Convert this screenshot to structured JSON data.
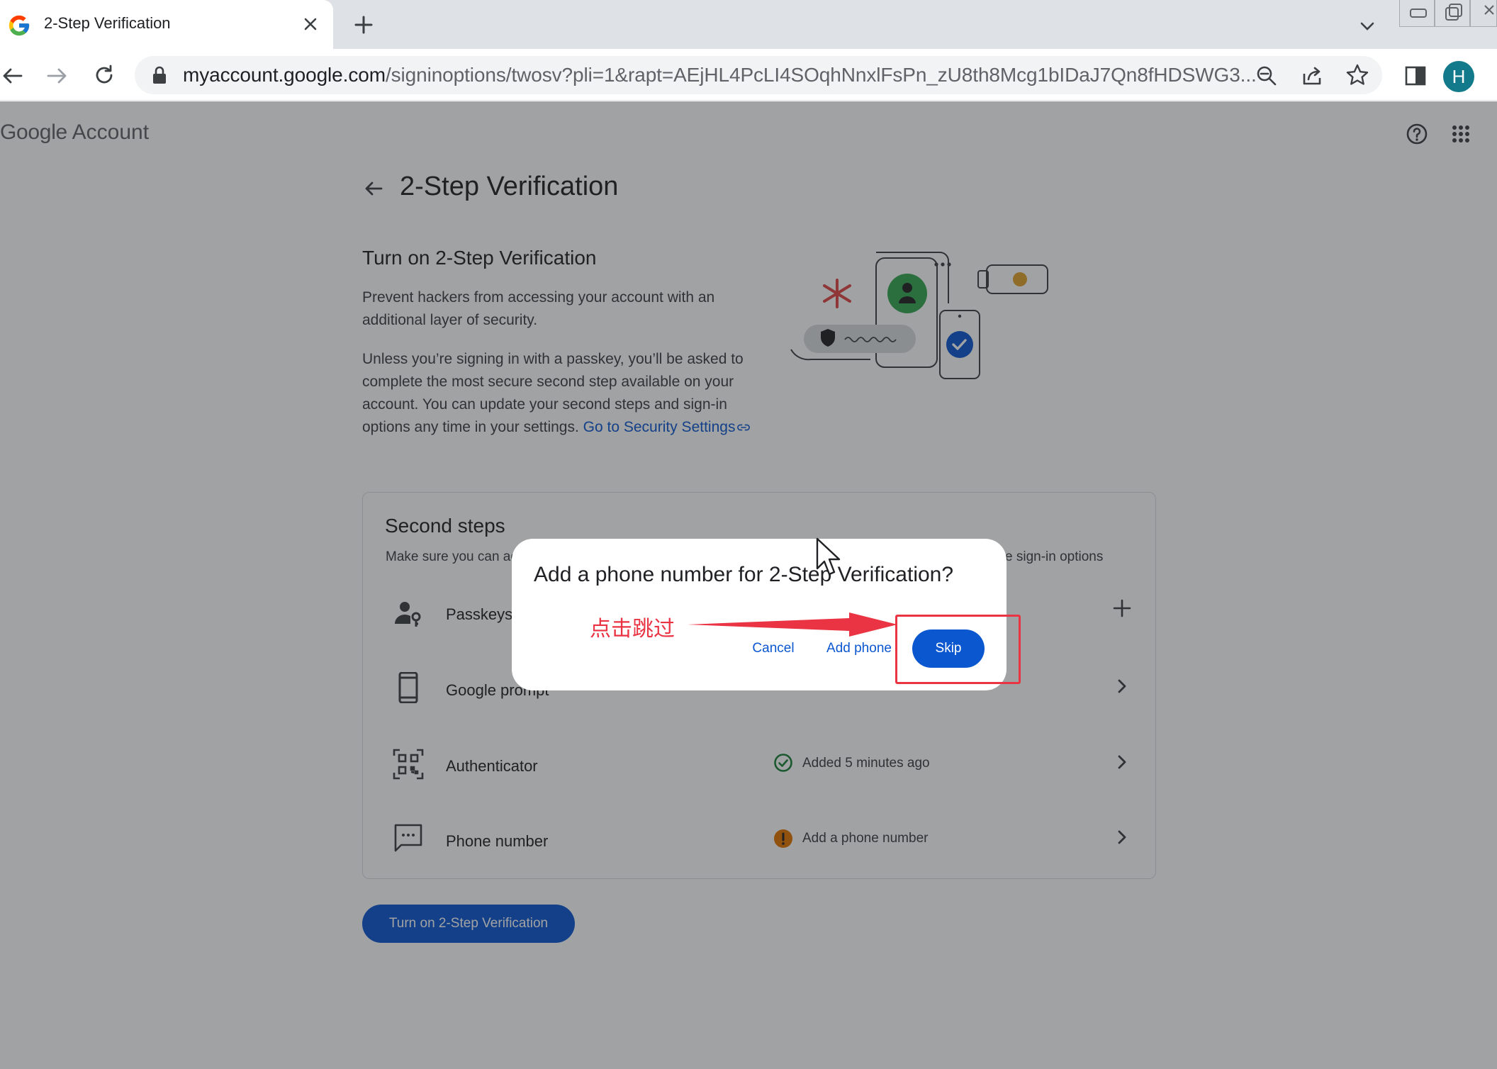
{
  "browser": {
    "tab_title": "2-Step Verification",
    "url_host": "myaccount.google.com",
    "url_path": "/signinoptions/twosv?pli=1&rapt=AEjHL4PcLI4SOqhNnxlFsPn_zU8th8Mcg1bIDaJ7Qn8fHDSWG3...",
    "avatar_letter": "H"
  },
  "header": {
    "logo_google": "Google",
    "logo_account": "Account",
    "page_title": "2-Step Verification"
  },
  "intro": {
    "title": "Turn on 2-Step Verification",
    "para1": "Prevent hackers from accessing your account with an additional layer of security.",
    "para2": "Unless you’re signing in with a passkey, you’ll be asked to complete the most secure second step available on your account. You can update your second steps and sign-in options any time in your settings.",
    "link": "Go to Security Settings"
  },
  "second_steps": {
    "title": "Second steps",
    "subtitle_start": "Make sure you can ac",
    "subtitle_end": "e sign-in options",
    "items": [
      {
        "label": "Passkeys",
        "status": ""
      },
      {
        "label": "Google prompt",
        "status": ""
      },
      {
        "label": "Authenticator",
        "status": "Added 5 minutes ago"
      },
      {
        "label": "Phone number",
        "status": "Add a phone number"
      }
    ]
  },
  "turn_on_button": "Turn on 2-Step Verification",
  "dialog": {
    "title": "Add a phone number for 2-Step Verification?",
    "cancel": "Cancel",
    "add_phone": "Add phone",
    "skip": "Skip"
  },
  "annotation": {
    "text": "点击跳过",
    "color": "#ea3343"
  },
  "colors": {
    "primary": "#0b57d0",
    "success": "#188038",
    "warning": "#e37400",
    "avatar": "#137a8c"
  }
}
